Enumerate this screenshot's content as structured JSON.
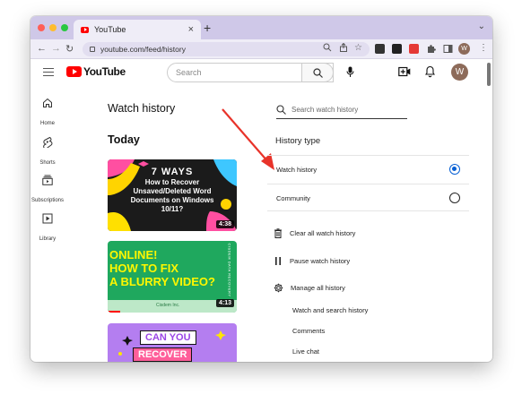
{
  "browser": {
    "tab_title": "YouTube",
    "tab_close": "×",
    "new_tab": "+",
    "tabs_menu": "⌄",
    "url": "youtube.com/feed/history",
    "profile_initial": "W",
    "traffic_lights": [
      "#ff5f57",
      "#febc2e",
      "#28c840"
    ],
    "back_icon": "←",
    "forward_icon": "→",
    "reload_icon": "↻",
    "menu_icon": "⋮",
    "extensions": [
      {
        "name": "m-extension-icon",
        "color": "#333333"
      },
      {
        "name": "k-extension-icon",
        "color": "#222222"
      },
      {
        "name": "red-extension-icon",
        "color": "#e53935"
      },
      {
        "name": "puzzle-icon",
        "color": "#555555"
      },
      {
        "name": "sidebar-icon",
        "color": "#555555"
      }
    ]
  },
  "masthead": {
    "logo_text": "YouTube",
    "search_placeholder": "Search",
    "avatar_initial": "W"
  },
  "guide": [
    {
      "label": "Home",
      "icon": "home-icon"
    },
    {
      "label": "Shorts",
      "icon": "shorts-icon"
    },
    {
      "label": "Subscriptions",
      "icon": "subscriptions-icon"
    },
    {
      "label": "Library",
      "icon": "library-icon"
    }
  ],
  "main": {
    "page_title": "Watch history",
    "section_title": "Today",
    "videos": [
      {
        "title_lines": [
          "7 WAYS",
          "How to Recover",
          "Unsaved/Deleted Word",
          "Documents on Windows",
          "10/11?"
        ],
        "duration": "4:38"
      },
      {
        "title_lines": [
          "ONLINE!",
          "HOW TO FIX",
          "A BLURRY VIDEO?"
        ],
        "side_text": "CISDEM DATA RECOVERY",
        "footer": "Cisdem Inc.",
        "duration": "4:13",
        "progress": 0.1
      },
      {
        "title_lines": [
          "CAN YOU",
          "RECOVER"
        ]
      }
    ]
  },
  "panel": {
    "search_placeholder": "Search watch history",
    "history_type_label": "History type",
    "options": [
      {
        "label": "Watch history",
        "selected": true
      },
      {
        "label": "Community",
        "selected": false
      }
    ],
    "actions": [
      {
        "label": "Clear all watch history",
        "icon": "trash-icon"
      },
      {
        "label": "Pause watch history",
        "icon": "pause-icon"
      },
      {
        "label": "Manage all history",
        "icon": "gear-icon"
      }
    ],
    "sub_links": [
      "Watch and search history",
      "Comments",
      "Live chat"
    ]
  },
  "colors": {
    "accent_blue": "#065fd4",
    "youtube_red": "#ff0000",
    "annotation_arrow": "#e8332a",
    "tab_strip": "#cfc8e8"
  }
}
